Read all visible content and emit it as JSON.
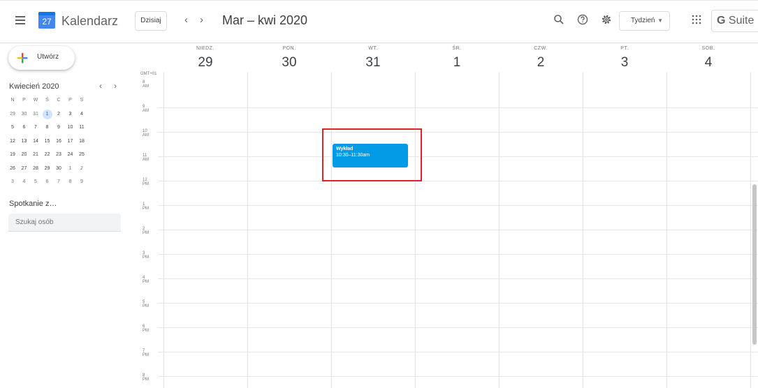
{
  "header": {
    "app_name": "Kalendarz",
    "logo_day": "27",
    "today_label": "Dzisiaj",
    "prev": "‹",
    "next": "›",
    "date_range": "Mar – kwi 2020",
    "view_label": "Tydzień",
    "view_caret": "▼",
    "brand_g": "G",
    "brand_suite": "Suite"
  },
  "sidebar": {
    "create_label": "Utwórz",
    "month_title": "Kwiecień 2020",
    "prev": "‹",
    "next": "›",
    "weekday_heads": [
      "N",
      "P",
      "W",
      "Ś",
      "C",
      "P",
      "S"
    ],
    "weeks": [
      [
        "29",
        "30",
        "31",
        "1",
        "2",
        "3",
        "4"
      ],
      [
        "5",
        "6",
        "7",
        "8",
        "9",
        "10",
        "11"
      ],
      [
        "12",
        "13",
        "14",
        "15",
        "16",
        "17",
        "18"
      ],
      [
        "19",
        "20",
        "21",
        "22",
        "23",
        "24",
        "25"
      ],
      [
        "26",
        "27",
        "28",
        "29",
        "30",
        "1",
        "2"
      ],
      [
        "3",
        "4",
        "5",
        "6",
        "7",
        "8",
        "9"
      ]
    ],
    "today_date": "1",
    "meet_title": "Spotkanie z…",
    "search_people_placeholder": "Szukaj osób"
  },
  "week": {
    "timezone": "GMT+01",
    "days": [
      {
        "name": "NIEDZ.",
        "date": "29"
      },
      {
        "name": "PON.",
        "date": "30"
      },
      {
        "name": "WT.",
        "date": "31"
      },
      {
        "name": "ŚR.",
        "date": "1"
      },
      {
        "name": "CZW.",
        "date": "2"
      },
      {
        "name": "PT.",
        "date": "3"
      },
      {
        "name": "SOB.",
        "date": "4"
      }
    ],
    "hours": [
      "8 AM",
      "9 AM",
      "10 AM",
      "11 AM",
      "12 PM",
      "1 PM",
      "2 PM",
      "3 PM",
      "4 PM",
      "5 PM",
      "6 PM",
      "7 PM",
      "8 PM"
    ]
  },
  "event": {
    "title": "Wykład",
    "time": "10:30–11:30am",
    "color": "#039be5"
  },
  "colors": {
    "accent": "#1a73e8",
    "highlight": "#d9252b"
  }
}
